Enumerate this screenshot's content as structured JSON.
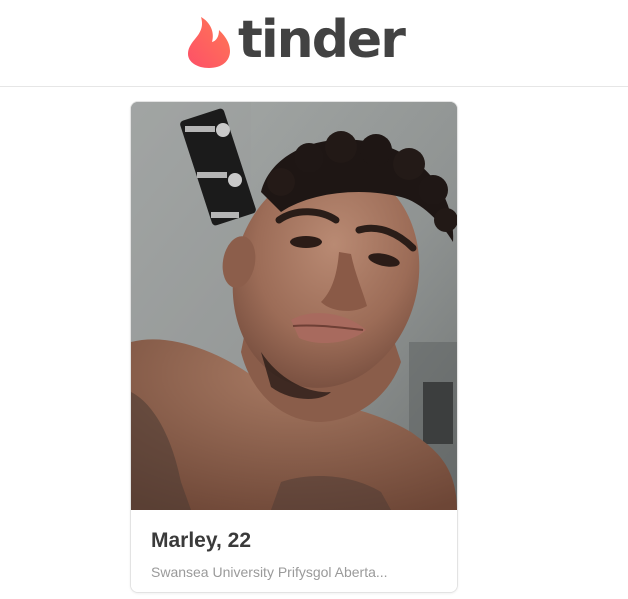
{
  "brand": {
    "wordmark": "tinder",
    "logo_icon": "flame-icon",
    "flame_gradient": [
      "#fd5068",
      "#ff7854"
    ],
    "wordmark_color": "#424242"
  },
  "profile_card": {
    "photo_icon": "profile-photo",
    "name": "Marley",
    "age": "22",
    "name_age": "Marley, 22",
    "school": "Swansea University Prifysgol Aberta..."
  },
  "colors": {
    "text_primary": "#3a3a3a",
    "text_secondary": "#9a9a9a",
    "divider": "#e6e6e6"
  }
}
